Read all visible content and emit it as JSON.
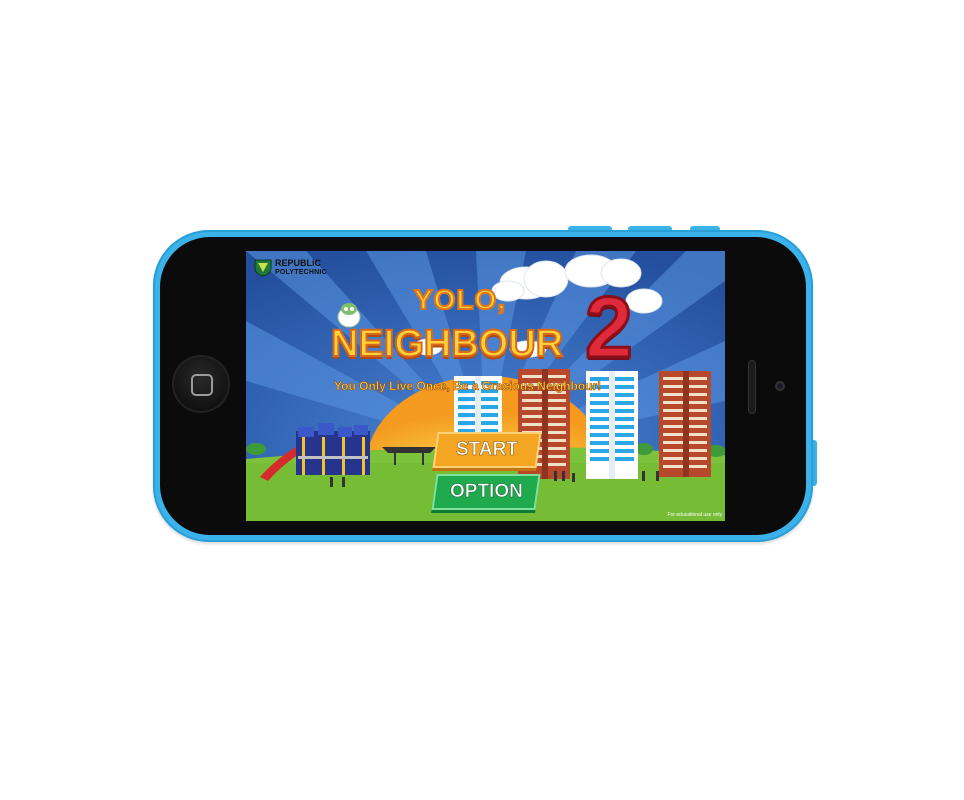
{
  "logo": {
    "line1": "REPUBLiC",
    "line2": "POLYTECHNIC"
  },
  "title": {
    "line1": "YOLO,",
    "line2": "NEIGHBOUR",
    "number": "2"
  },
  "tagline": "You Only Live Once, Be a Gracious Neighbour!",
  "menu": {
    "start_label": "START",
    "option_label": "OPTION"
  },
  "footer": "For educational use only",
  "colors": {
    "phone": "#3bb3ea",
    "sky": "#2f63b6",
    "grass": "#7cc23a",
    "start": "#f4a623",
    "option": "#1faa4e",
    "title": "#ffd23a",
    "number": "#e02a3a"
  }
}
